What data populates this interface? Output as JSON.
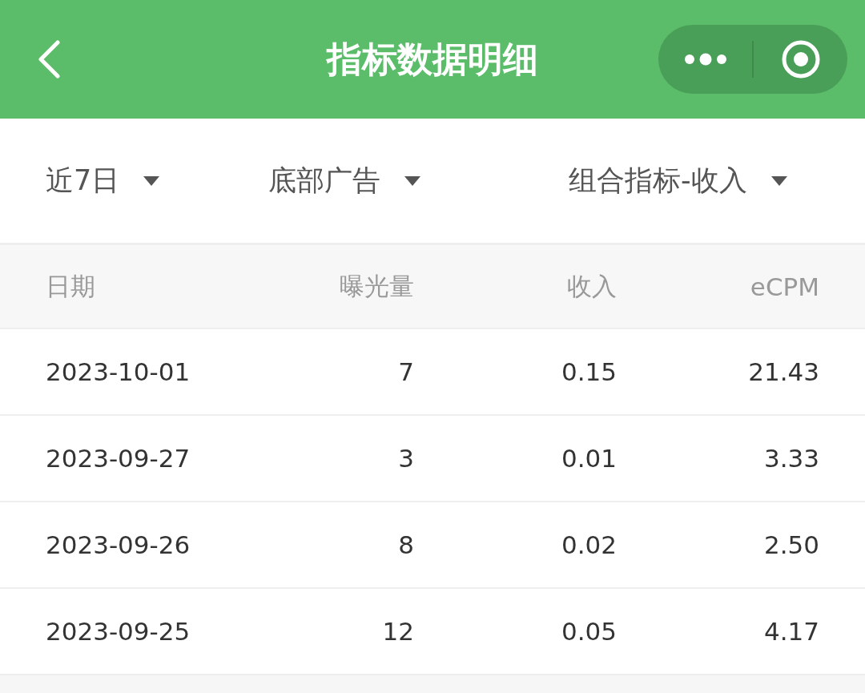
{
  "header": {
    "title": "指标数据明细"
  },
  "filters": [
    {
      "label": "近7日"
    },
    {
      "label": "底部广告"
    },
    {
      "label": "组合指标-收入"
    }
  ],
  "table": {
    "columns": [
      "日期",
      "曝光量",
      "收入",
      "eCPM"
    ],
    "rows": [
      {
        "cells": [
          "2023-10-01",
          "7",
          "0.15",
          "21.43"
        ]
      },
      {
        "cells": [
          "2023-09-27",
          "3",
          "0.01",
          "3.33"
        ]
      },
      {
        "cells": [
          "2023-09-26",
          "8",
          "0.02",
          "2.50"
        ]
      },
      {
        "cells": [
          "2023-09-25",
          "12",
          "0.05",
          "4.17"
        ]
      }
    ]
  }
}
